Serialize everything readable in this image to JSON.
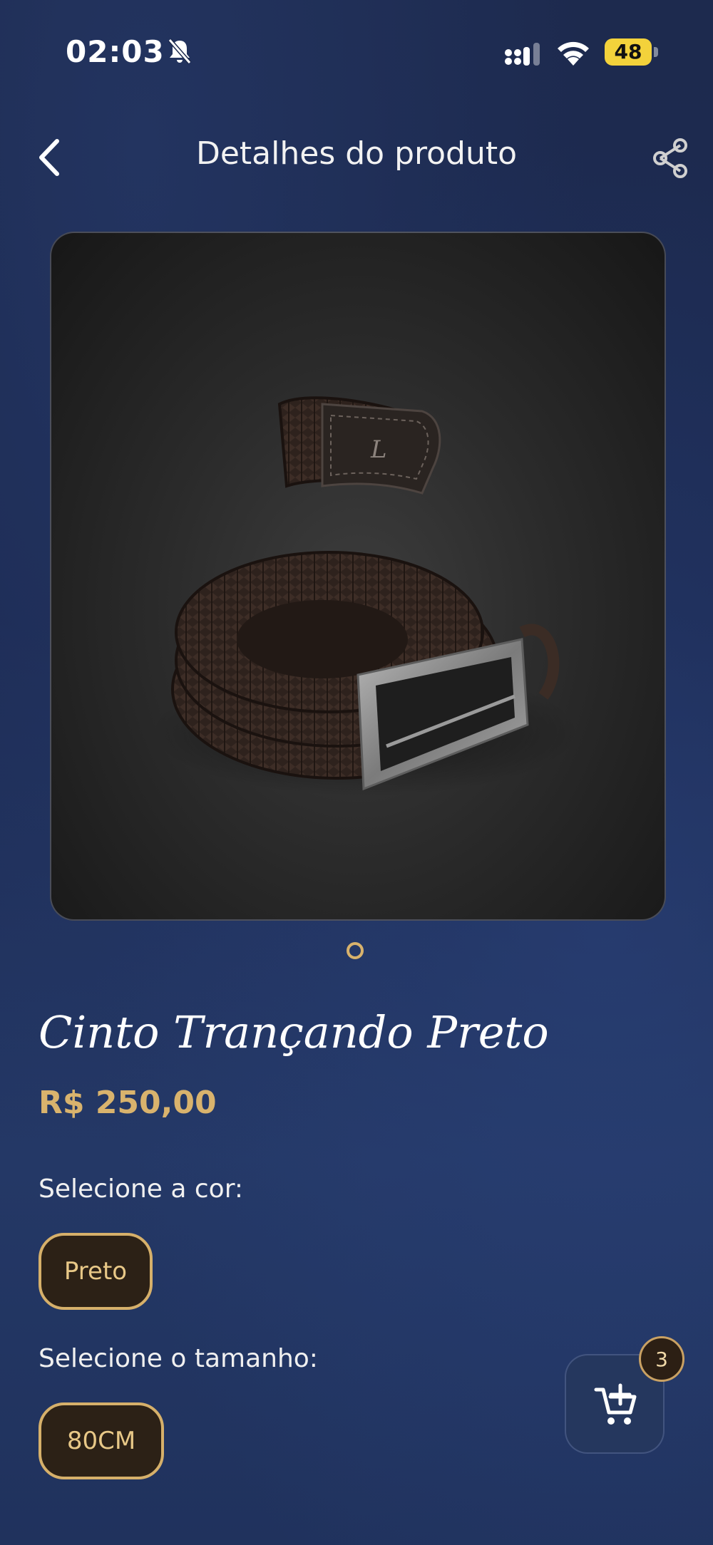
{
  "status_bar": {
    "time": "02:03",
    "battery": "48",
    "icons": [
      "bell-off-icon",
      "signal-icon",
      "wifi-icon",
      "battery-icon"
    ]
  },
  "header": {
    "title": "Detalhes do produto",
    "back_icon": "chevron-left-icon",
    "share_icon": "share-icon"
  },
  "product": {
    "image": "braided-belt-photo",
    "image_count": 1,
    "current_image": 1,
    "name": "Cinto Trançando Preto",
    "price": "R$ 250,00"
  },
  "options": {
    "color_label": "Selecione a cor:",
    "color_value": "Preto",
    "size_label": "Selecione o tamanho:",
    "size_value": "80CM"
  },
  "cart": {
    "icon": "cart-add-icon",
    "count": "3"
  },
  "colors": {
    "accent_gold": "#d9b36d",
    "chip_bg": "#2c2116",
    "fab_bg": "#25375e"
  }
}
